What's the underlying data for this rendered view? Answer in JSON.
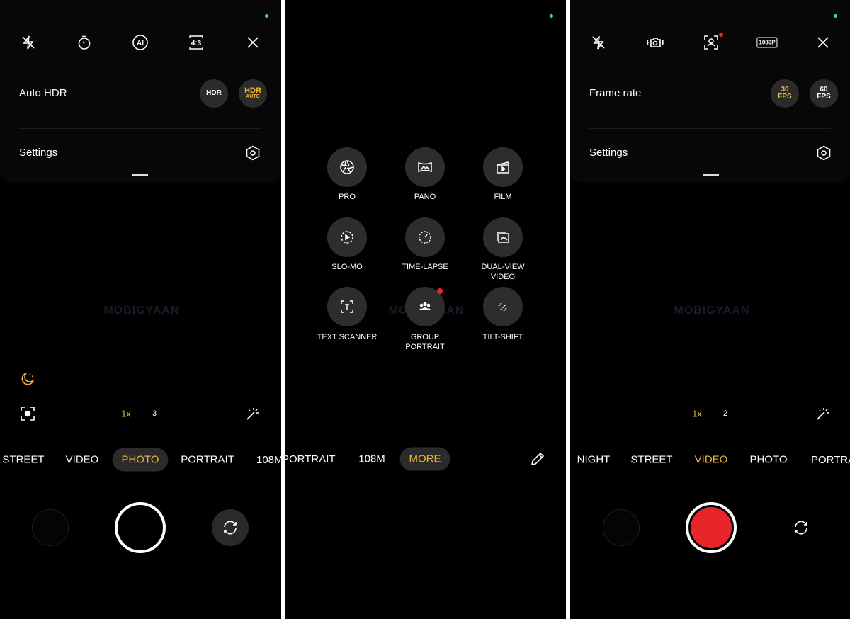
{
  "colors": {
    "accent": "#f0b53c",
    "record": "#e8262a",
    "background": "#000000",
    "notification": "#e8262a"
  },
  "watermark": "MOBIGYAAN",
  "photo_screen": {
    "top_icons": [
      "flash-off-icon",
      "timer-icon",
      "ai-icon",
      "aspect-ratio-icon",
      "close-icon"
    ],
    "aspect_ratio": "4:3",
    "ai": "AI",
    "auto_hdr_label": "Auto HDR",
    "hdr_off": "HDR",
    "hdr_auto": {
      "line1": "HDR",
      "line2": "AUTO"
    },
    "settings_label": "Settings",
    "zoom": [
      "1x",
      "3"
    ],
    "modes": [
      "STREET",
      "VIDEO",
      "PHOTO",
      "PORTRAIT",
      "108M"
    ],
    "active_mode": "PHOTO"
  },
  "more_screen": {
    "items": [
      {
        "label": "PRO",
        "icon": "aperture-icon"
      },
      {
        "label": "PANO",
        "icon": "panorama-icon"
      },
      {
        "label": "FILM",
        "icon": "clapperboard-icon"
      },
      {
        "label": "SLO-MO",
        "icon": "slow-motion-icon"
      },
      {
        "label": "TIME-LAPSE",
        "icon": "time-lapse-icon"
      },
      {
        "label": "DUAL-VIEW VIDEO",
        "icon": "dual-view-icon"
      },
      {
        "label": "TEXT SCANNER",
        "icon": "text-scanner-icon"
      },
      {
        "label": "GROUP PORTRAIT",
        "icon": "group-icon"
      },
      {
        "label": "TILT-SHIFT",
        "icon": "tilt-shift-icon"
      }
    ],
    "modes": [
      "PORTRAIT",
      "108M",
      "MORE"
    ],
    "active_mode": "MORE"
  },
  "video_screen": {
    "top_icons": [
      "flash-off-icon",
      "stabilization-icon",
      "face-frame-icon",
      "resolution-icon",
      "close-icon"
    ],
    "resolution": "1080P",
    "frame_rate_label": "Frame rate",
    "fps30": {
      "line1": "30",
      "line2": "FPS"
    },
    "fps60": {
      "line1": "60",
      "line2": "FPS"
    },
    "selected_fps": "30",
    "settings_label": "Settings",
    "zoom": [
      "1x",
      "2"
    ],
    "modes": [
      "NIGHT",
      "STREET",
      "VIDEO",
      "PHOTO",
      "PORTRAIT"
    ],
    "active_mode": "VIDEO"
  }
}
